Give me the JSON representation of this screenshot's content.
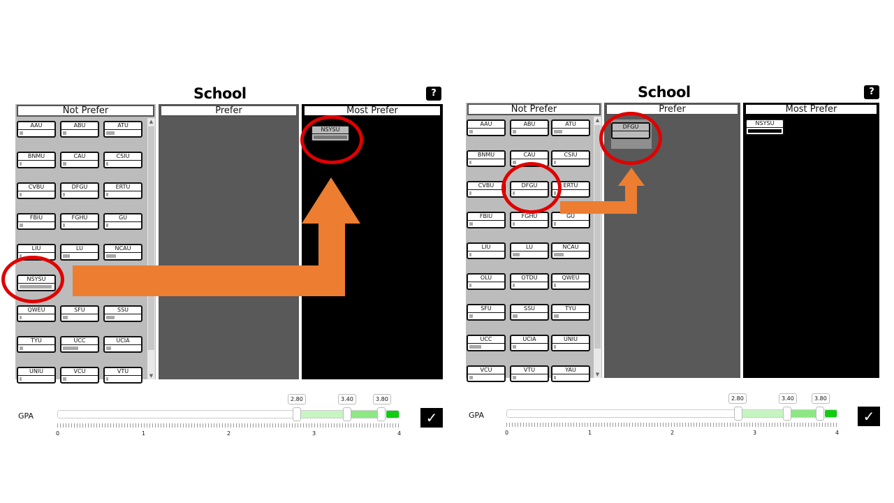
{
  "left": {
    "title": "School",
    "help": "?",
    "columns": {
      "not_prefer": "Not Prefer",
      "prefer": "Prefer",
      "most_prefer": "Most Prefer"
    },
    "not_prefer_rows": [
      [
        {
          "label": "AAU",
          "fill": 0.1
        },
        {
          "label": "ABU",
          "fill": 0.1
        },
        {
          "label": "ATU",
          "fill": 0.25
        }
      ],
      [
        {
          "label": "BNMU",
          "fill": 0.0
        },
        {
          "label": "CAU",
          "fill": 0.1
        },
        {
          "label": "CSIU",
          "fill": 0.05
        }
      ],
      [
        {
          "label": "CVBU",
          "fill": 0.0
        },
        {
          "label": "DFGU",
          "fill": 0.0
        },
        {
          "label": "ERTU",
          "fill": 0.05
        }
      ],
      [
        {
          "label": "FBIU",
          "fill": 0.1
        },
        {
          "label": "FGHU",
          "fill": 0.05
        },
        {
          "label": "GU",
          "fill": 0.05
        }
      ],
      [
        {
          "label": "LIU",
          "fill": 0.0
        },
        {
          "label": "LU",
          "fill": 0.2
        },
        {
          "label": "NCAU",
          "fill": 0.3
        }
      ],
      [
        {
          "label": "NSYSU",
          "fill": 0.95
        },
        {
          "label": "",
          "fill": 0.0
        },
        {
          "label": "",
          "fill": 0.0
        }
      ],
      [
        {
          "label": "QWEU",
          "fill": 0.05
        },
        {
          "label": "SFU",
          "fill": 0.15
        },
        {
          "label": "SSU",
          "fill": 0.25
        }
      ],
      [
        {
          "label": "TYU",
          "fill": 0.1
        },
        {
          "label": "UCC",
          "fill": 0.45
        },
        {
          "label": "UCIA",
          "fill": 0.15
        }
      ],
      [
        {
          "label": "UNIU",
          "fill": 0.0
        },
        {
          "label": "VCU",
          "fill": 0.1
        },
        {
          "label": "VTU",
          "fill": 0.05
        }
      ]
    ],
    "most_prefer_items": [
      {
        "label": "NSYSU",
        "fill": 0.95
      }
    ],
    "gpa": {
      "label": "GPA",
      "values": [
        "2.80",
        "3.40",
        "3.80"
      ],
      "axis_ticks": [
        "0",
        "1",
        "2",
        "3",
        "4"
      ]
    },
    "confirm": "✓"
  },
  "right": {
    "title": "School",
    "help": "?",
    "columns": {
      "not_prefer": "Not Prefer",
      "prefer": "Prefer",
      "most_prefer": "Most Prefer"
    },
    "not_prefer_rows": [
      [
        {
          "label": "AAU",
          "fill": 0.1
        },
        {
          "label": "ABU",
          "fill": 0.1
        },
        {
          "label": "ATU",
          "fill": 0.25
        }
      ],
      [
        {
          "label": "BNMU",
          "fill": 0.0
        },
        {
          "label": "CAU",
          "fill": 0.1
        },
        {
          "label": "CSIU",
          "fill": 0.05
        }
      ],
      [
        {
          "label": "CVBU",
          "fill": 0.0
        },
        {
          "label": "DFGU",
          "fill": 0.0
        },
        {
          "label": "ERTU",
          "fill": 0.05
        }
      ],
      [
        {
          "label": "FBIU",
          "fill": 0.1
        },
        {
          "label": "FGHU",
          "fill": 0.05
        },
        {
          "label": "GU",
          "fill": 0.05
        }
      ],
      [
        {
          "label": "LIU",
          "fill": 0.0
        },
        {
          "label": "LU",
          "fill": 0.2
        },
        {
          "label": "NCAU",
          "fill": 0.3
        }
      ],
      [
        {
          "label": "OLU",
          "fill": 0.0
        },
        {
          "label": "OTDU",
          "fill": 0.0
        },
        {
          "label": "QWEU",
          "fill": 0.05
        }
      ],
      [
        {
          "label": "SFU",
          "fill": 0.1
        },
        {
          "label": "SSU",
          "fill": 0.15
        },
        {
          "label": "TYU",
          "fill": 0.15
        }
      ],
      [
        {
          "label": "UCC",
          "fill": 0.35
        },
        {
          "label": "UCIA",
          "fill": 0.1
        },
        {
          "label": "UNIU",
          "fill": 0.0
        }
      ],
      [
        {
          "label": "VCU",
          "fill": 0.1
        },
        {
          "label": "VTU",
          "fill": 0.1
        },
        {
          "label": "YAU",
          "fill": 0.05
        }
      ]
    ],
    "prefer_items": [
      {
        "label": "DFGU",
        "fill": 0.0
      }
    ],
    "most_prefer_items": [
      {
        "label": "NSYSU",
        "fill": 0.95
      }
    ],
    "gpa": {
      "label": "GPA",
      "values": [
        "2.80",
        "3.40",
        "3.80"
      ],
      "axis_ticks": [
        "0",
        "1",
        "2",
        "3",
        "4"
      ]
    },
    "confirm": "✓"
  },
  "colors": {
    "annotation_circle": "#e00000",
    "annotation_arrow": "#ed7d31",
    "gpa_accent": "#11cc11"
  }
}
